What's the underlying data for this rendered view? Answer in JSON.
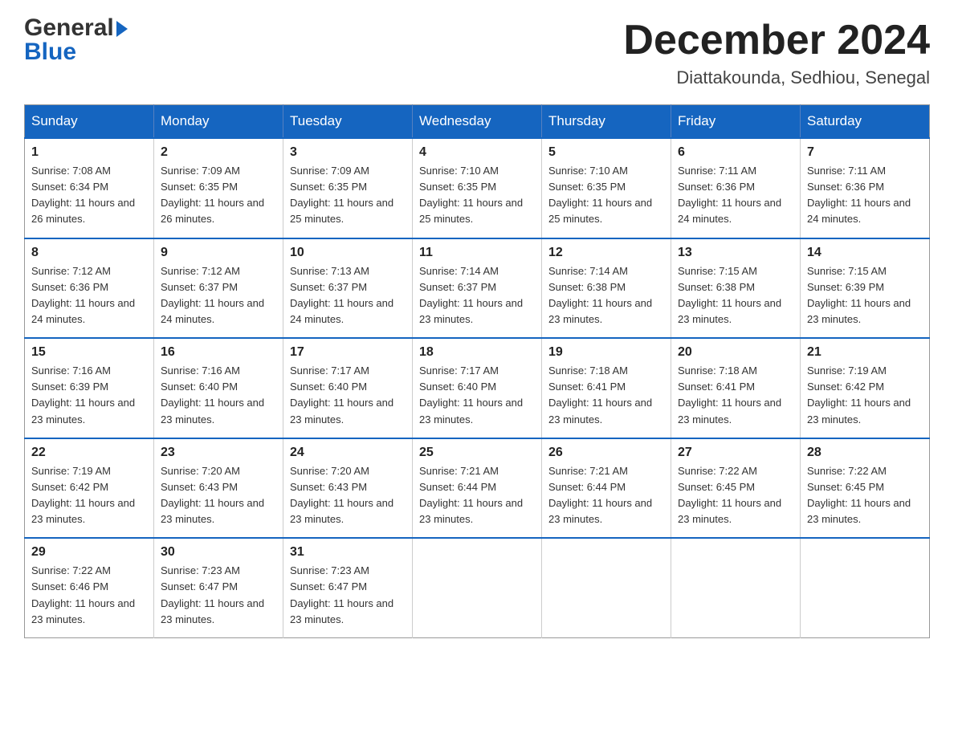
{
  "header": {
    "logo_line1": "General",
    "logo_line2": "Blue",
    "month_title": "December 2024",
    "location": "Diattakounda, Sedhiou, Senegal"
  },
  "calendar": {
    "days_of_week": [
      "Sunday",
      "Monday",
      "Tuesday",
      "Wednesday",
      "Thursday",
      "Friday",
      "Saturday"
    ],
    "weeks": [
      [
        {
          "day": "1",
          "sunrise": "7:08 AM",
          "sunset": "6:34 PM",
          "daylight": "11 hours and 26 minutes."
        },
        {
          "day": "2",
          "sunrise": "7:09 AM",
          "sunset": "6:35 PM",
          "daylight": "11 hours and 26 minutes."
        },
        {
          "day": "3",
          "sunrise": "7:09 AM",
          "sunset": "6:35 PM",
          "daylight": "11 hours and 25 minutes."
        },
        {
          "day": "4",
          "sunrise": "7:10 AM",
          "sunset": "6:35 PM",
          "daylight": "11 hours and 25 minutes."
        },
        {
          "day": "5",
          "sunrise": "7:10 AM",
          "sunset": "6:35 PM",
          "daylight": "11 hours and 25 minutes."
        },
        {
          "day": "6",
          "sunrise": "7:11 AM",
          "sunset": "6:36 PM",
          "daylight": "11 hours and 24 minutes."
        },
        {
          "day": "7",
          "sunrise": "7:11 AM",
          "sunset": "6:36 PM",
          "daylight": "11 hours and 24 minutes."
        }
      ],
      [
        {
          "day": "8",
          "sunrise": "7:12 AM",
          "sunset": "6:36 PM",
          "daylight": "11 hours and 24 minutes."
        },
        {
          "day": "9",
          "sunrise": "7:12 AM",
          "sunset": "6:37 PM",
          "daylight": "11 hours and 24 minutes."
        },
        {
          "day": "10",
          "sunrise": "7:13 AM",
          "sunset": "6:37 PM",
          "daylight": "11 hours and 24 minutes."
        },
        {
          "day": "11",
          "sunrise": "7:14 AM",
          "sunset": "6:37 PM",
          "daylight": "11 hours and 23 minutes."
        },
        {
          "day": "12",
          "sunrise": "7:14 AM",
          "sunset": "6:38 PM",
          "daylight": "11 hours and 23 minutes."
        },
        {
          "day": "13",
          "sunrise": "7:15 AM",
          "sunset": "6:38 PM",
          "daylight": "11 hours and 23 minutes."
        },
        {
          "day": "14",
          "sunrise": "7:15 AM",
          "sunset": "6:39 PM",
          "daylight": "11 hours and 23 minutes."
        }
      ],
      [
        {
          "day": "15",
          "sunrise": "7:16 AM",
          "sunset": "6:39 PM",
          "daylight": "11 hours and 23 minutes."
        },
        {
          "day": "16",
          "sunrise": "7:16 AM",
          "sunset": "6:40 PM",
          "daylight": "11 hours and 23 minutes."
        },
        {
          "day": "17",
          "sunrise": "7:17 AM",
          "sunset": "6:40 PM",
          "daylight": "11 hours and 23 minutes."
        },
        {
          "day": "18",
          "sunrise": "7:17 AM",
          "sunset": "6:40 PM",
          "daylight": "11 hours and 23 minutes."
        },
        {
          "day": "19",
          "sunrise": "7:18 AM",
          "sunset": "6:41 PM",
          "daylight": "11 hours and 23 minutes."
        },
        {
          "day": "20",
          "sunrise": "7:18 AM",
          "sunset": "6:41 PM",
          "daylight": "11 hours and 23 minutes."
        },
        {
          "day": "21",
          "sunrise": "7:19 AM",
          "sunset": "6:42 PM",
          "daylight": "11 hours and 23 minutes."
        }
      ],
      [
        {
          "day": "22",
          "sunrise": "7:19 AM",
          "sunset": "6:42 PM",
          "daylight": "11 hours and 23 minutes."
        },
        {
          "day": "23",
          "sunrise": "7:20 AM",
          "sunset": "6:43 PM",
          "daylight": "11 hours and 23 minutes."
        },
        {
          "day": "24",
          "sunrise": "7:20 AM",
          "sunset": "6:43 PM",
          "daylight": "11 hours and 23 minutes."
        },
        {
          "day": "25",
          "sunrise": "7:21 AM",
          "sunset": "6:44 PM",
          "daylight": "11 hours and 23 minutes."
        },
        {
          "day": "26",
          "sunrise": "7:21 AM",
          "sunset": "6:44 PM",
          "daylight": "11 hours and 23 minutes."
        },
        {
          "day": "27",
          "sunrise": "7:22 AM",
          "sunset": "6:45 PM",
          "daylight": "11 hours and 23 minutes."
        },
        {
          "day": "28",
          "sunrise": "7:22 AM",
          "sunset": "6:45 PM",
          "daylight": "11 hours and 23 minutes."
        }
      ],
      [
        {
          "day": "29",
          "sunrise": "7:22 AM",
          "sunset": "6:46 PM",
          "daylight": "11 hours and 23 minutes."
        },
        {
          "day": "30",
          "sunrise": "7:23 AM",
          "sunset": "6:47 PM",
          "daylight": "11 hours and 23 minutes."
        },
        {
          "day": "31",
          "sunrise": "7:23 AM",
          "sunset": "6:47 PM",
          "daylight": "11 hours and 23 minutes."
        },
        null,
        null,
        null,
        null
      ]
    ]
  }
}
